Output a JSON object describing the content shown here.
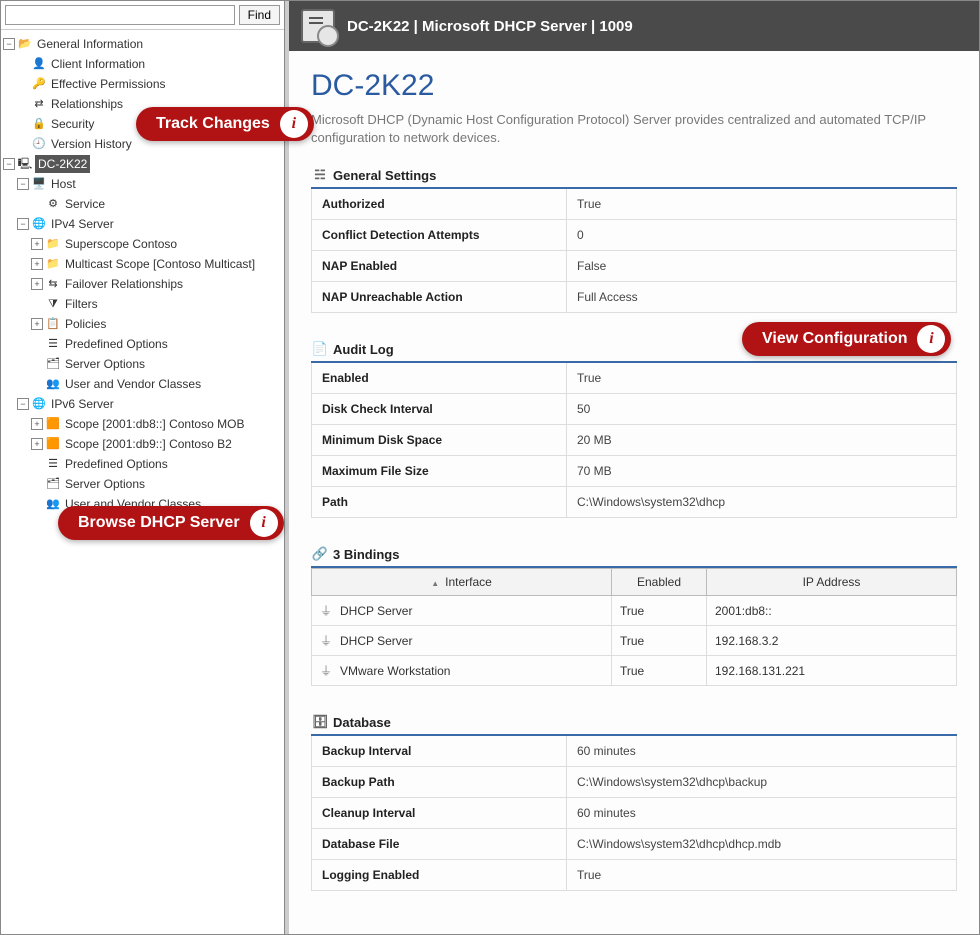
{
  "search": {
    "placeholder": "",
    "button": "Find"
  },
  "tree": {
    "general_info": "General Information",
    "client_info": "Client Information",
    "effective_perms": "Effective Permissions",
    "relationships": "Relationships",
    "security": "Security",
    "version_history": "Version History",
    "dc": "DC-2K22",
    "host": "Host",
    "service": "Service",
    "ipv4": "IPv4 Server",
    "superscope": "Superscope Contoso",
    "multicast": "Multicast Scope [Contoso Multicast]",
    "failover": "Failover Relationships",
    "filters": "Filters",
    "policies": "Policies",
    "predef_opts": "Predefined Options",
    "server_opts": "Server Options",
    "uv_classes": "User and Vendor Classes",
    "ipv6": "IPv6 Server",
    "scope1": "Scope [2001:db8::] Contoso MOB",
    "scope2": "Scope [2001:db9::] Contoso B2"
  },
  "header": {
    "title": "DC-2K22 | Microsoft DHCP Server | 1009"
  },
  "page": {
    "title": "DC-2K22",
    "desc": "Microsoft DHCP (Dynamic Host Configuration Protocol) Server provides centralized and automated TCP/IP configuration to network devices."
  },
  "sections": {
    "general": {
      "title": "General Settings",
      "rows": [
        {
          "k": "Authorized",
          "v": "True"
        },
        {
          "k": "Conflict Detection Attempts",
          "v": "0"
        },
        {
          "k": "NAP Enabled",
          "v": "False"
        },
        {
          "k": "NAP Unreachable Action",
          "v": "Full Access"
        }
      ]
    },
    "audit": {
      "title": "Audit Log",
      "rows": [
        {
          "k": "Enabled",
          "v": "True"
        },
        {
          "k": "Disk Check Interval",
          "v": "50"
        },
        {
          "k": "Minimum Disk Space",
          "v": "20 MB"
        },
        {
          "k": "Maximum File Size",
          "v": "70 MB"
        },
        {
          "k": "Path",
          "v": "C:\\Windows\\system32\\dhcp"
        }
      ]
    },
    "bindings": {
      "title": "3 Bindings",
      "headers": {
        "iface": "Interface",
        "enabled": "Enabled",
        "ip": "IP Address"
      },
      "rows": [
        {
          "iface": "DHCP Server",
          "enabled": "True",
          "ip": "2001:db8::"
        },
        {
          "iface": "DHCP Server",
          "enabled": "True",
          "ip": "192.168.3.2"
        },
        {
          "iface": "VMware Workstation",
          "enabled": "True",
          "ip": "192.168.131.221"
        }
      ]
    },
    "database": {
      "title": "Database",
      "rows": [
        {
          "k": "Backup Interval",
          "v": "60 minutes"
        },
        {
          "k": "Backup Path",
          "v": "C:\\Windows\\system32\\dhcp\\backup"
        },
        {
          "k": "Cleanup Interval",
          "v": "60 minutes"
        },
        {
          "k": "Database File",
          "v": "C:\\Windows\\system32\\dhcp\\dhcp.mdb"
        },
        {
          "k": "Logging Enabled",
          "v": "True"
        }
      ]
    }
  },
  "callouts": {
    "track": "Track Changes",
    "browse": "Browse DHCP Server",
    "view_cfg": "View Configuration"
  }
}
